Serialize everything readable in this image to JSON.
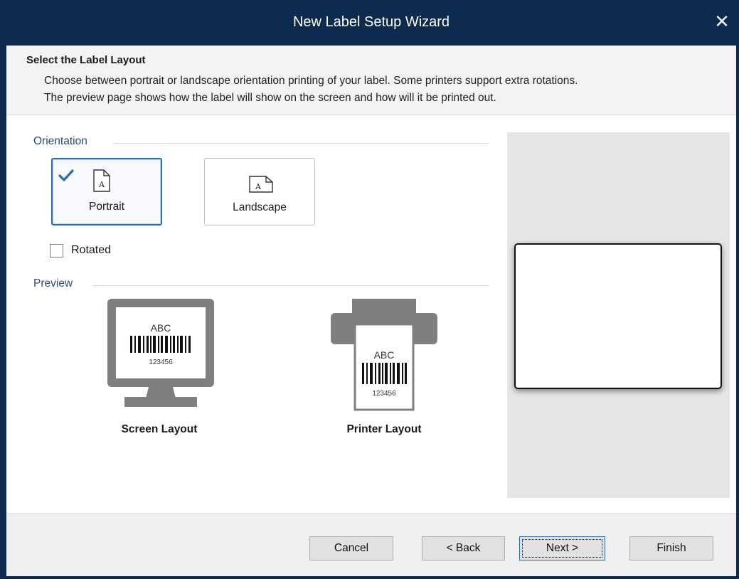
{
  "window": {
    "title": "New Label Setup Wizard",
    "close_glyph": "✕"
  },
  "header": {
    "title": "Select the Label Layout",
    "description_line1": "Choose between portrait or landscape orientation printing of your label. Some printers support extra rotations.",
    "description_line2": "The preview page shows how the label will show on the screen and how will it be printed out."
  },
  "orientation": {
    "section_label": "Orientation",
    "options": [
      {
        "label": "Portrait",
        "icon": "portrait-page-icon",
        "selected": true
      },
      {
        "label": "Landscape",
        "icon": "landscape-page-icon",
        "selected": false
      }
    ],
    "page_glyph": "A",
    "rotated": {
      "label": "Rotated",
      "checked": false
    }
  },
  "preview": {
    "section_label": "Preview",
    "screen": {
      "caption": "Screen Layout",
      "icon": "monitor-icon",
      "sample_text": "ABC",
      "barcode_number": "123456"
    },
    "printer": {
      "caption": "Printer Layout",
      "icon": "printer-icon",
      "sample_text": "ABC",
      "barcode_number": "123456"
    }
  },
  "footer": {
    "cancel": "Cancel",
    "back": "< Back",
    "next": "Next >",
    "finish": "Finish"
  },
  "colors": {
    "titlebar": "#0d2a4f",
    "accent": "#2b6cb0",
    "icon_gray": "#7f7f7f"
  }
}
